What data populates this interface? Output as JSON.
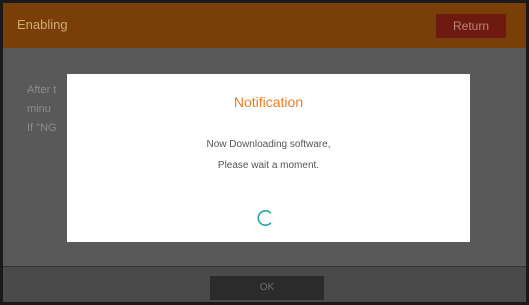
{
  "header": {
    "title": "Enabling",
    "return_label": "Return"
  },
  "background_text": [
    "After t",
    "minu",
    "If \"NG"
  ],
  "dialog": {
    "title": "Notification",
    "message_line1": "Now Downloading software,",
    "message_line2": "Please wait a moment.",
    "spinner_icon": "loading-spinner-icon",
    "accent_color": "#ef7d22",
    "spinner_color": "#2aa3a3"
  },
  "footer": {
    "ok_label": "OK"
  }
}
